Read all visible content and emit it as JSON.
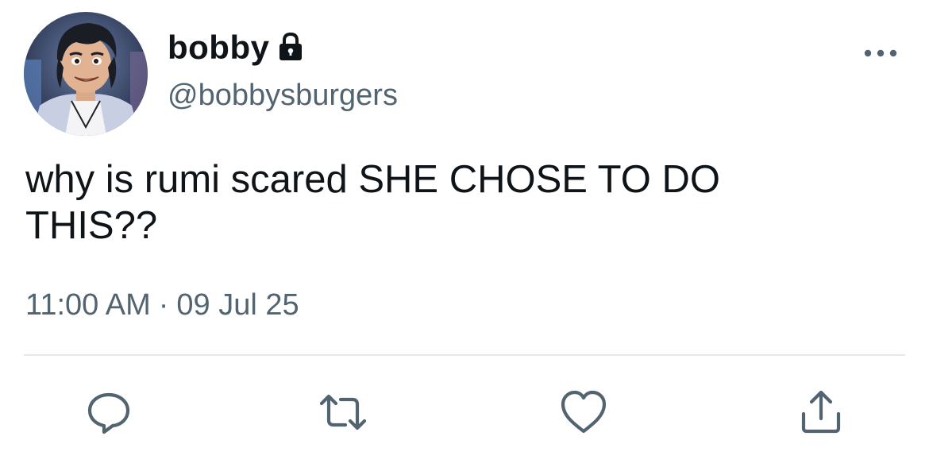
{
  "user": {
    "display_name": "bobby",
    "handle": "@bobbysburgers",
    "protected_icon": "lock-icon"
  },
  "tweet": {
    "text": "why is rumi scared SHE CHOSE TO DO\nTHIS??",
    "time": "11:00 AM",
    "separator": "·",
    "date": "09 Jul 25"
  },
  "actions": {
    "reply_icon": "speech-bubble-icon",
    "retweet_icon": "retweet-icon",
    "like_icon": "heart-icon",
    "share_icon": "share-upload-icon"
  },
  "colors": {
    "text_primary": "#0f1419",
    "text_secondary": "#536471",
    "icon": "#536471",
    "divider": "#e5e8eb"
  }
}
